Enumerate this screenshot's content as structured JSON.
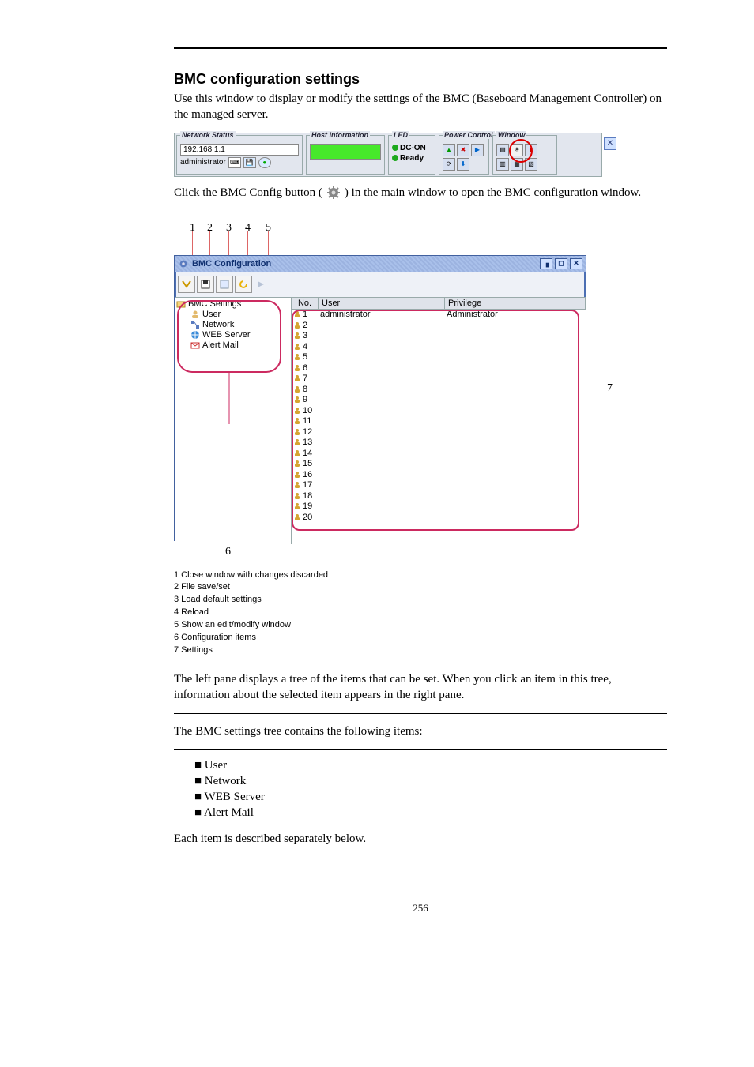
{
  "doc": {
    "heading": "BMC configuration settings",
    "intro": "Use this window to display or modify the settings of the BMC (Baseboard Management Controller) on the managed server.",
    "open_para_prefix": "Click the BMC Config button (",
    "open_para_suffix": ") in the main window to open the BMC configuration window.",
    "tree_desc": "The left pane displays a tree of the items that can be set. When you click an item in this tree, information about the selected item appears in the right pane.",
    "summary": "The BMC settings tree contains the following items:",
    "rule_items": [
      "■  User",
      "■  Network",
      "■  WEB Server",
      "■  Alert Mail"
    ],
    "item_desc": "Each item is described separately below.",
    "page_number": "256"
  },
  "callouts": {
    "c1": "1",
    "c2": "2",
    "c3": "3",
    "c4": "4",
    "c5": "5",
    "c6": "6",
    "c7": "7",
    "t1": "1 Close window with changes discarded",
    "t2": "2 File save/set",
    "t3": "3 Load default settings",
    "t4": "4 Reload",
    "t5": "5 Show an edit/modify window",
    "t6": "6 Configuration items",
    "t7": "7 Settings"
  },
  "statusbar": {
    "groups": {
      "net": "Network Status",
      "host": "Host Information",
      "led": "LED",
      "power": "Power Control",
      "window": "Window"
    },
    "ip": "192.168.1.1",
    "user": "administrator",
    "led_dc": "DC-ON",
    "led_ready": "Ready"
  },
  "bmcwin": {
    "title": "BMC Configuration",
    "tree": {
      "root": "BMC Settings",
      "user": "User",
      "network": "Network",
      "web": "WEB Server",
      "alert": "Alert Mail"
    },
    "headers": {
      "no": "No.",
      "user": "User",
      "priv": "Privilege"
    },
    "rows": [
      {
        "no": "1",
        "user": "administrator",
        "priv": "Administrator"
      },
      {
        "no": "2",
        "user": "",
        "priv": ""
      },
      {
        "no": "3",
        "user": "",
        "priv": ""
      },
      {
        "no": "4",
        "user": "",
        "priv": ""
      },
      {
        "no": "5",
        "user": "",
        "priv": ""
      },
      {
        "no": "6",
        "user": "",
        "priv": ""
      },
      {
        "no": "7",
        "user": "",
        "priv": ""
      },
      {
        "no": "8",
        "user": "",
        "priv": ""
      },
      {
        "no": "9",
        "user": "",
        "priv": ""
      },
      {
        "no": "10",
        "user": "",
        "priv": ""
      },
      {
        "no": "11",
        "user": "",
        "priv": ""
      },
      {
        "no": "12",
        "user": "",
        "priv": ""
      },
      {
        "no": "13",
        "user": "",
        "priv": ""
      },
      {
        "no": "14",
        "user": "",
        "priv": ""
      },
      {
        "no": "15",
        "user": "",
        "priv": ""
      },
      {
        "no": "16",
        "user": "",
        "priv": ""
      },
      {
        "no": "17",
        "user": "",
        "priv": ""
      },
      {
        "no": "18",
        "user": "",
        "priv": ""
      },
      {
        "no": "19",
        "user": "",
        "priv": ""
      },
      {
        "no": "20",
        "user": "",
        "priv": ""
      }
    ]
  }
}
